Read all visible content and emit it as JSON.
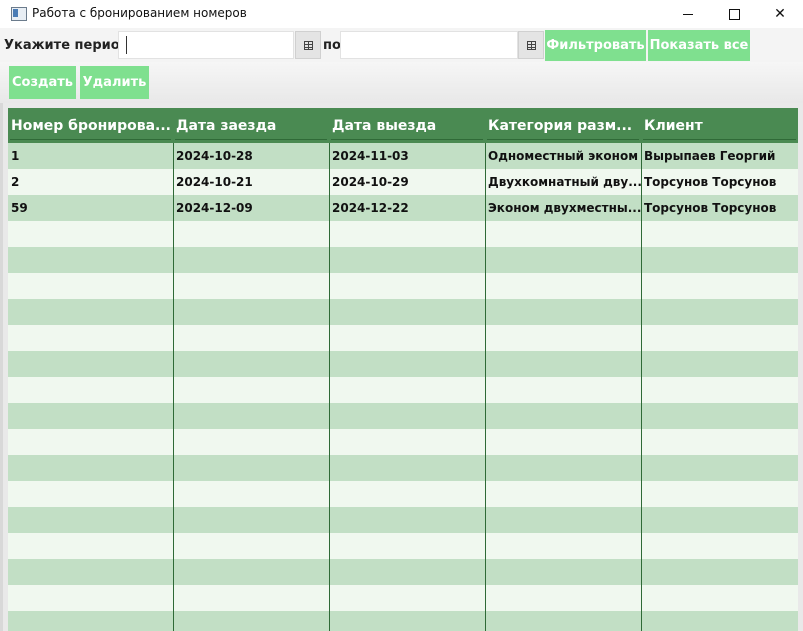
{
  "window": {
    "title": "Работа с бронированием номеров"
  },
  "filter": {
    "period_label": "Укажите период",
    "to_label": "по",
    "date_from_value": "",
    "date_to_value": "",
    "filter_button": "Фильтровать",
    "show_all_button": "Показать все"
  },
  "actions": {
    "create_button": "Создать",
    "delete_button": "Удалить"
  },
  "colors": {
    "accent_button": "#7fe08f",
    "table_header": "#4a8a52",
    "row_stripe": "#c2dfc5",
    "row_light": "#f0f8ef"
  },
  "table": {
    "columns": [
      "Номер бронирова...",
      "Дата заезда",
      "Дата выезда",
      "Категория разм...",
      "Клиент"
    ],
    "rows": [
      [
        "1",
        "2024-10-28",
        "2024-11-03",
        "Одноместный эконом",
        "Вырыпаев Георгий"
      ],
      [
        "2",
        "2024-10-21",
        "2024-10-29",
        "Двухкомнатный дву...",
        "Торсунов Торсунов"
      ],
      [
        "59",
        "2024-12-09",
        "2024-12-22",
        "Эконом двухместны...",
        "Торсунов Торсунов"
      ]
    ]
  }
}
